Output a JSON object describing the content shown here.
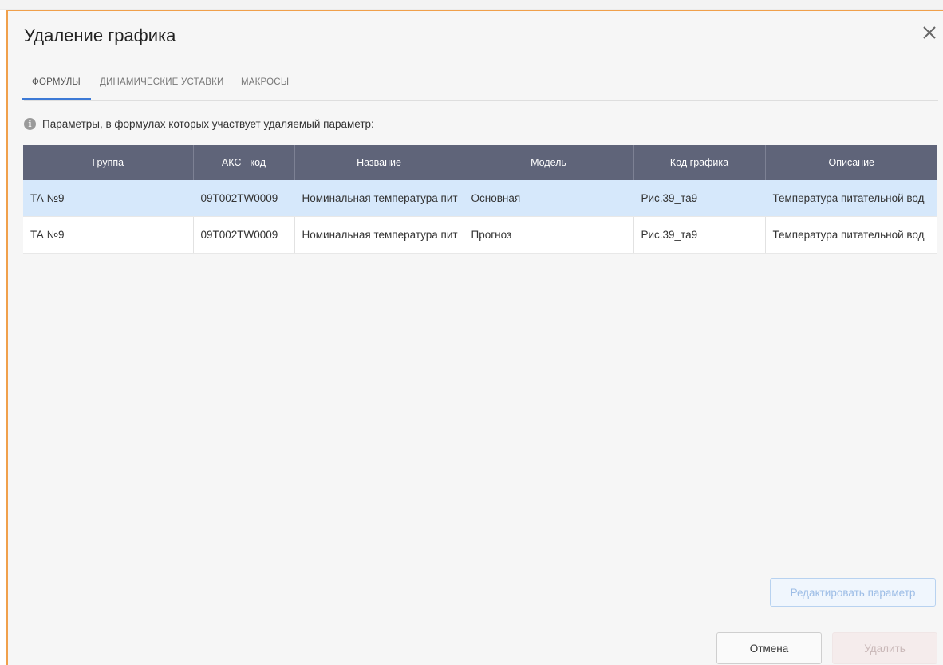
{
  "dialog": {
    "title": "Удаление графика",
    "close_icon": "close-icon"
  },
  "tabs": [
    {
      "label": "ФОРМУЛЫ",
      "active": true
    },
    {
      "label": "ДИНАМИЧЕСКИЕ УСТАВКИ",
      "active": false
    },
    {
      "label": "МАКРОСЫ",
      "active": false
    }
  ],
  "info": {
    "icon": "info-icon",
    "text": "Параметры, в формулах которых участвует удаляемый параметр:"
  },
  "table": {
    "columns": [
      "Группа",
      "АКС - код",
      "Название",
      "Модель",
      "Код графика",
      "Описание"
    ],
    "rows": [
      {
        "group": "ТА №9",
        "aks_code": "09T002TW0009",
        "name": "Номинальная температура пит",
        "model": "Основная",
        "chart_code": "Рис.39_та9",
        "description": "Температура питательной вод",
        "selected": true
      },
      {
        "group": "ТА №9",
        "aks_code": "09T002TW0009",
        "name": "Номинальная температура пит",
        "model": "Прогноз",
        "chart_code": "Рис.39_та9",
        "description": "Температура питательной вод",
        "selected": false
      }
    ]
  },
  "buttons": {
    "edit_param": "Редактировать параметр",
    "cancel": "Отмена",
    "delete": "Удалить"
  },
  "colors": {
    "accent_border": "#f0a04b",
    "table_header": "#5f6479",
    "selected_row": "#d6e8fb",
    "active_tab": "#3d7ad6"
  }
}
